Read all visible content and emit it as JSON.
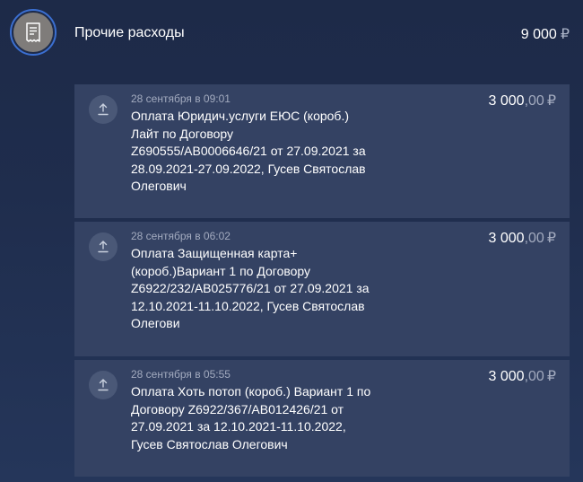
{
  "category": {
    "title": "Прочие расходы",
    "total_amount": "9 000",
    "currency": "₽",
    "icon": "receipt-icon",
    "ring_color": "#3b6fd1",
    "icon_bg_color": "#7f7c7a"
  },
  "transactions": [
    {
      "date": "28 сентября в 09:01",
      "description": "Оплата Юридич.услуги ЕЮС (короб.)\nЛайт по Договору\nZ690555/АВ0006646/21 от 27.09.2021 за\n28.09.2021-27.09.2022, Гусев Святослав\nОлегович",
      "amount_int": "3 000",
      "amount_dec": ",00",
      "currency": "₽",
      "icon": "upload-icon"
    },
    {
      "date": "28 сентября в 06:02",
      "description": "Оплата Защищенная карта+\n(короб.)Вариант 1 по Договору\nZ6922/232/АВ025776/21 от 27.09.2021 за\n12.10.2021-11.10.2022, Гусев Святослав\nОлегови",
      "amount_int": "3 000",
      "amount_dec": ",00",
      "currency": "₽",
      "icon": "upload-icon"
    },
    {
      "date": "28 сентября в 05:55",
      "description": "Оплата Хоть потоп (короб.) Вариант 1 по\nДоговору Z6922/367/АВ012426/21 от\n27.09.2021 за 12.10.2021-11.10.2022,\nГусев Святослав Олегович",
      "amount_int": "3 000",
      "amount_dec": ",00",
      "currency": "₽",
      "icon": "upload-icon"
    }
  ]
}
